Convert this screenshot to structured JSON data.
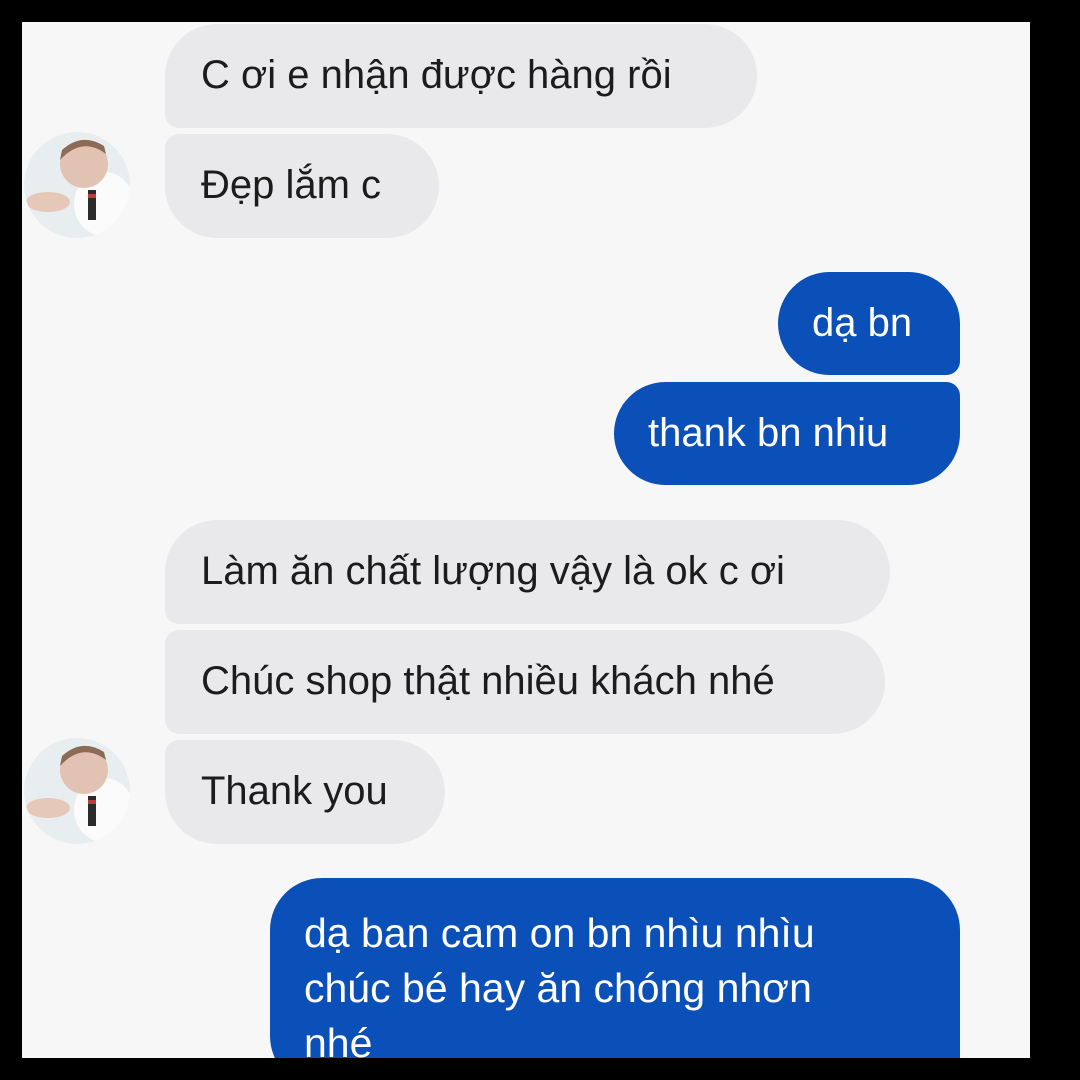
{
  "conversation": {
    "incoming_group_1": [
      {
        "text": "C ơi e nhận được hàng rồi"
      },
      {
        "text": "Đẹp lắm c"
      }
    ],
    "outgoing_group_1": [
      {
        "text": "dạ bn"
      },
      {
        "text": "thank bn nhiu"
      }
    ],
    "incoming_group_2": [
      {
        "text": "Làm ăn chất lượng vậy là ok c ơi"
      },
      {
        "text": "Chúc shop thật nhiều khách nhé"
      },
      {
        "text": "Thank you"
      }
    ],
    "outgoing_group_2": {
      "lines": [
        "dạ ban cam on bn nhìu nhìu",
        "chúc bé hay ăn chóng nhơn",
        "nhé"
      ]
    }
  },
  "contact": {
    "avatar_icon": "child-photo-avatar"
  },
  "colors": {
    "outgoing_bubble": "#0b4fb8",
    "incoming_bubble": "#e9e9eb",
    "background": "#f7f7f7",
    "border": "#000000"
  }
}
